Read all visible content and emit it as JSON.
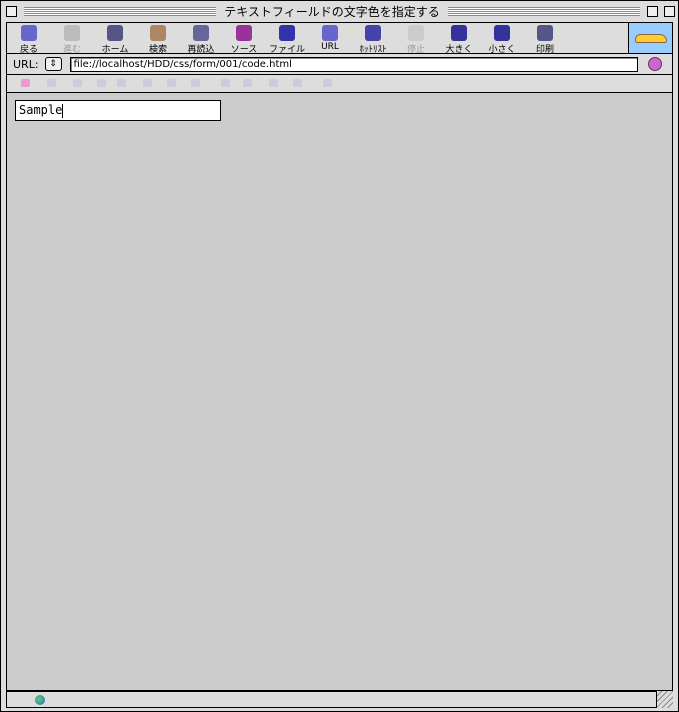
{
  "window": {
    "title": "テキストフィールドの文字色を指定する"
  },
  "toolbar": {
    "items": [
      {
        "label": "戻る",
        "icon": "back-arrow-icon",
        "color": "#66c",
        "enabled": true
      },
      {
        "label": "進む",
        "icon": "forward-arrow-icon",
        "color": "#bbb",
        "enabled": false
      },
      {
        "label": "ホーム",
        "icon": "home-icon",
        "color": "#558",
        "enabled": true
      },
      {
        "label": "検索",
        "icon": "magnifier-icon",
        "color": "#a86",
        "enabled": true
      },
      {
        "label": "再読込",
        "icon": "reload-icon",
        "color": "#669",
        "enabled": true
      },
      {
        "label": "ソース",
        "icon": "source-icon",
        "color": "#939",
        "enabled": true
      },
      {
        "label": "ファイル",
        "icon": "file-save-icon",
        "color": "#33a",
        "enabled": true
      },
      {
        "label": "URL",
        "icon": "globe-icon",
        "color": "#66c",
        "enabled": true
      },
      {
        "label": "ﾎｯﾄﾘｽﾄ",
        "icon": "hotlist-icon",
        "color": "#44a",
        "enabled": true
      },
      {
        "label": "停止",
        "icon": "stop-icon",
        "color": "#ccc",
        "enabled": false
      },
      {
        "label": "大きく",
        "icon": "bigger-text-icon",
        "color": "#339",
        "enabled": true
      },
      {
        "label": "小さく",
        "icon": "smaller-text-icon",
        "color": "#339",
        "enabled": true
      },
      {
        "label": "印刷",
        "icon": "printer-icon",
        "color": "#558",
        "enabled": true
      }
    ]
  },
  "urlbar": {
    "label": "URL:",
    "value": "file://localhost/HDD/css/form/001/code.html"
  },
  "page": {
    "text_field_value": "Sample"
  }
}
